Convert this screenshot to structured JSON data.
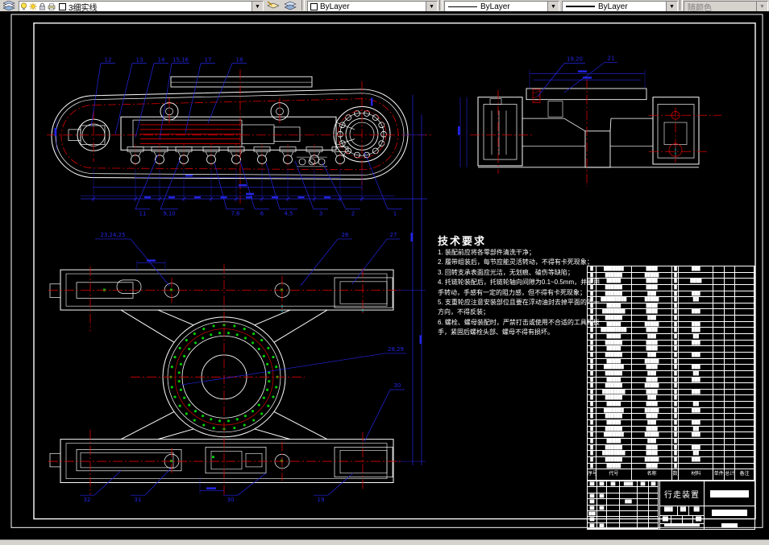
{
  "toolbar": {
    "layer_control": {
      "value": "3细实线"
    },
    "color_control": {
      "value": "ByLayer"
    },
    "linetype_control": {
      "value": "ByLayer"
    },
    "lineweight_control": {
      "value": "ByLayer"
    },
    "plotstyle_control": {
      "value": "随颜色"
    }
  },
  "colors": {
    "lines": "#ffffff",
    "centerlines": "#dd0000",
    "dimensions": "#2525e8",
    "bolt_marks": "#00cc00",
    "aux": "#00e0e0",
    "toolbar_bg": "#d6d3ce",
    "canvas_bg": "#000000"
  },
  "tech_requirements": {
    "title": "技术要求",
    "lines": [
      "1. 装配前应将各零部件清洗干净；",
      "2. 履带组装后，每节应能灵活转动，不得有卡死现象；",
      "3. 回转支承表面应光洁，无划痕、磕伤等缺陷；",
      "4. 托链轮装配后，托链轮轴向间隙为0.1~0.5mm，并能用",
      "手转动，手感有一定的阻力感，但不得有卡死现象；",
      "5. 支重轮应注意安装部位且要在浮动油封去掉平面的同一",
      "方向，不得反装；",
      "6. 螺栓、螺母装配时，严禁打击或使用不合适的工具和扳",
      "手，紧固后螺栓头部、螺母不得有损坏。"
    ]
  },
  "balloons": {
    "side_top": [
      "12",
      "13",
      "14",
      "15,16",
      "17",
      "18"
    ],
    "side_bottom": [
      "11",
      "9,10",
      "7,8",
      "6",
      "4,5",
      "3",
      "2",
      "1"
    ],
    "end_view": [
      "19,20",
      "21"
    ],
    "plan_top": [
      "23,24,25",
      "26",
      "27"
    ],
    "plan_right": [
      "28,29",
      "30"
    ],
    "plan_bottom": [
      "32",
      "31",
      "30",
      "19"
    ]
  },
  "parts_list": {
    "headers": [
      "序号",
      "代号",
      "名称",
      "数量",
      "材料",
      "单件",
      "总计",
      "备注",
      ""
    ],
    "row_blob_lengths": [
      [
        7,
        4,
        3
      ],
      [
        6,
        5,
        0
      ],
      [
        5,
        4,
        4
      ],
      [
        6,
        4,
        0
      ],
      [
        6,
        3,
        3
      ],
      [
        9,
        5,
        2
      ],
      [
        5,
        4,
        0
      ],
      [
        8,
        4,
        3
      ],
      [
        6,
        3,
        0
      ],
      [
        5,
        5,
        3
      ],
      [
        9,
        4,
        3
      ],
      [
        5,
        3,
        2
      ],
      [
        6,
        4,
        3
      ],
      [
        5,
        4,
        0
      ],
      [
        6,
        3,
        3
      ],
      [
        5,
        5,
        0
      ],
      [
        7,
        4,
        3
      ],
      [
        6,
        3,
        2
      ],
      [
        5,
        4,
        3
      ],
      [
        6,
        5,
        0
      ],
      [
        8,
        4,
        3
      ],
      [
        6,
        3,
        0
      ],
      [
        5,
        4,
        2
      ],
      [
        7,
        5,
        3
      ],
      [
        6,
        4,
        0
      ],
      [
        5,
        3,
        3
      ],
      [
        6,
        4,
        2
      ],
      [
        7,
        5,
        3
      ],
      [
        5,
        3,
        0
      ],
      [
        6,
        4,
        3
      ],
      [
        8,
        4,
        2
      ],
      [
        6,
        5,
        3
      ],
      [
        5,
        4,
        0
      ]
    ]
  },
  "title_block": {
    "title": "行走装置",
    "left_blobs": [
      {
        "i": 0,
        "t": "██"
      },
      {
        "i": 1,
        "t": "██"
      },
      {
        "i": 2,
        "t": "██"
      },
      {
        "i": 3,
        "t": "████"
      },
      {
        "i": 4,
        "t": "██"
      },
      {
        "i": 5,
        "t": "██"
      },
      {
        "i": 12,
        "t": "██"
      },
      {
        "i": 13,
        "t": "██"
      },
      {
        "i": 18,
        "t": "██"
      },
      {
        "i": 21,
        "t": "███"
      },
      {
        "i": 24,
        "t": "██"
      },
      {
        "i": 25,
        "t": "██"
      },
      {
        "i": 30,
        "t": "███"
      },
      {
        "i": 36,
        "t": "██"
      },
      {
        "i": 42,
        "t": "██"
      },
      {
        "i": 43,
        "t": "██"
      }
    ],
    "mid_row2": [
      "███",
      "██",
      "██"
    ],
    "mid_row3": [
      "██",
      "",
      "",
      "██"
    ]
  }
}
